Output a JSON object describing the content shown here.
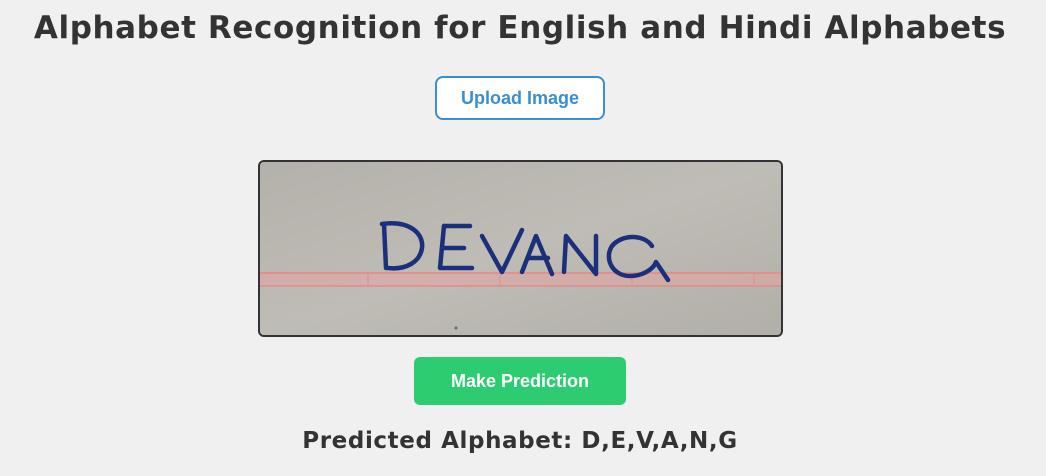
{
  "page": {
    "title": "Alphabet Recognition for English and Hindi Alphabets"
  },
  "upload": {
    "label": "Upload Image"
  },
  "preview": {
    "handwritten_text": "DEVANG",
    "ink_color": "#1c2f7a",
    "paper_color": "#b9b6b0",
    "rule_color": "#e08a8a"
  },
  "predict": {
    "label": "Make Prediction",
    "color": "#2ecc71"
  },
  "result": {
    "text": "Predicted Alphabet: D,E,V,A,N,G"
  },
  "colors": {
    "background": "#f0f0f0",
    "title_text": "#333333",
    "upload_accent": "#3a8fd0"
  }
}
